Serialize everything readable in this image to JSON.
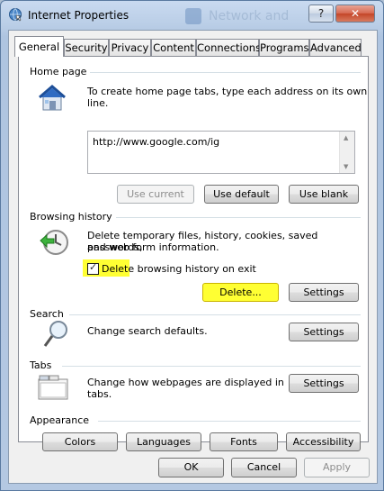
{
  "window": {
    "title": "Internet Properties",
    "help_label": "?",
    "close_label": "✕",
    "background_ghost_text": "Network and"
  },
  "tabs": [
    {
      "label": "General",
      "active": true
    },
    {
      "label": "Security"
    },
    {
      "label": "Privacy"
    },
    {
      "label": "Content"
    },
    {
      "label": "Connections"
    },
    {
      "label": "Programs"
    },
    {
      "label": "Advanced"
    }
  ],
  "home_page": {
    "section_title": "Home page",
    "description": "To create home page tabs, type each address on its own line.",
    "url_value": "http://www.google.com/ig",
    "buttons": {
      "use_current": "Use current",
      "use_default": "Use default",
      "use_blank": "Use blank"
    }
  },
  "browsing_history": {
    "section_title": "Browsing history",
    "description_line1": "Delete temporary files, history, cookies, saved passwords,",
    "description_line2": "and web form information.",
    "checkbox_label": "Delete browsing history on exit",
    "checkbox_checked": true,
    "buttons": {
      "delete": "Delete...",
      "settings": "Settings"
    }
  },
  "search": {
    "section_title": "Search",
    "description": "Change search defaults.",
    "settings_label": "Settings"
  },
  "tabs_section": {
    "section_title": "Tabs",
    "description_line1": "Change how webpages are displayed in",
    "description_line2": "tabs.",
    "settings_label": "Settings"
  },
  "appearance": {
    "section_title": "Appearance",
    "buttons": {
      "colors": "Colors",
      "languages": "Languages",
      "fonts": "Fonts",
      "accessibility": "Accessibility"
    }
  },
  "dialog_buttons": {
    "ok": "OK",
    "cancel": "Cancel",
    "apply": "Apply"
  },
  "colors": {
    "highlight": "#ffff33",
    "close": "#c44528",
    "accent": "#3a6ea5"
  }
}
